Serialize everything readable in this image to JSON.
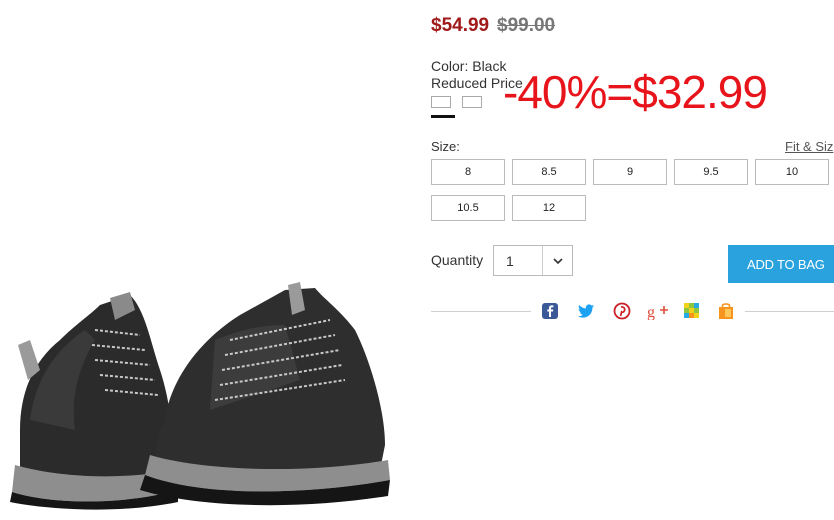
{
  "price": {
    "sale": "$54.99",
    "original": "$99.00"
  },
  "color": {
    "label": "Color: Black",
    "note": "Reduced Price"
  },
  "promo_text": "-40%=$32.99",
  "size": {
    "label": "Size:",
    "fit_link": "Fit & Siz",
    "options": [
      "8",
      "8.5",
      "9",
      "9.5",
      "10",
      "10.5",
      "12"
    ]
  },
  "quantity": {
    "label": "Quantity",
    "value": "1"
  },
  "add_to_bag": "ADD TO BAG",
  "share_icons": [
    "facebook-icon",
    "twitter-icon",
    "pinterest-icon",
    "google-plus-icon",
    "pixel-icon",
    "shopping-bag-icon"
  ],
  "colors": {
    "sale_price": "#a01a1a",
    "promo": "#e8141b",
    "button": "#2aa2de"
  }
}
